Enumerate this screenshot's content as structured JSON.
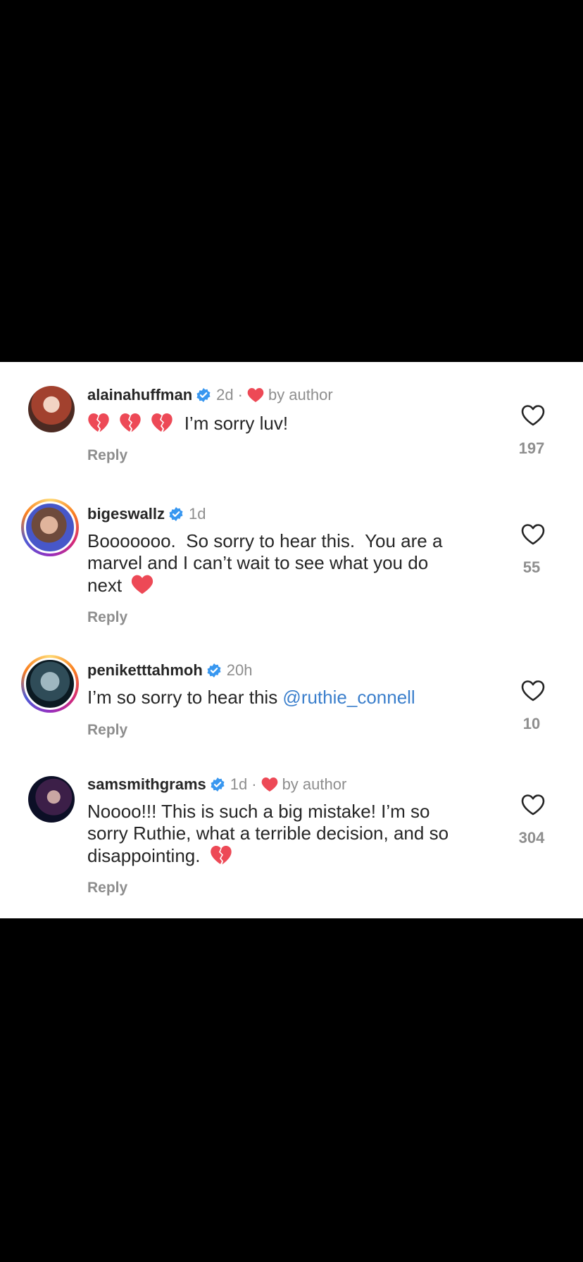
{
  "comments": [
    {
      "username": "alainahuffman",
      "time": "2d",
      "separator": "·",
      "by_author": "by author",
      "text": "I’m sorry luv!",
      "reply": "Reply",
      "likes": "197"
    },
    {
      "username": "bigeswallz",
      "time": "1d",
      "text_line1": "Booooooo.  So sorry to hear this.  You are a",
      "text_line2": "marvel and I can’t wait to see what you do",
      "text_line3": "next",
      "reply": "Reply",
      "likes": "55"
    },
    {
      "username": "peniketttahmoh",
      "time": "20h",
      "text": "I’m so sorry to hear this ",
      "mention": "@ruthie_connell",
      "reply": "Reply",
      "likes": "10"
    },
    {
      "username": "samsmithgrams",
      "time": "1d",
      "separator": "·",
      "by_author": "by author",
      "text_line1": "Noooo!!! This is such a big mistake! I’m so",
      "text_line2": "sorry Ruthie, what a terrible decision, and so",
      "text_line3": "disappointing.",
      "reply": "Reply",
      "likes": "304"
    }
  ],
  "colors": {
    "verified": "#3897f0",
    "heart": "#ed4956",
    "mention": "#3b7fcc"
  }
}
